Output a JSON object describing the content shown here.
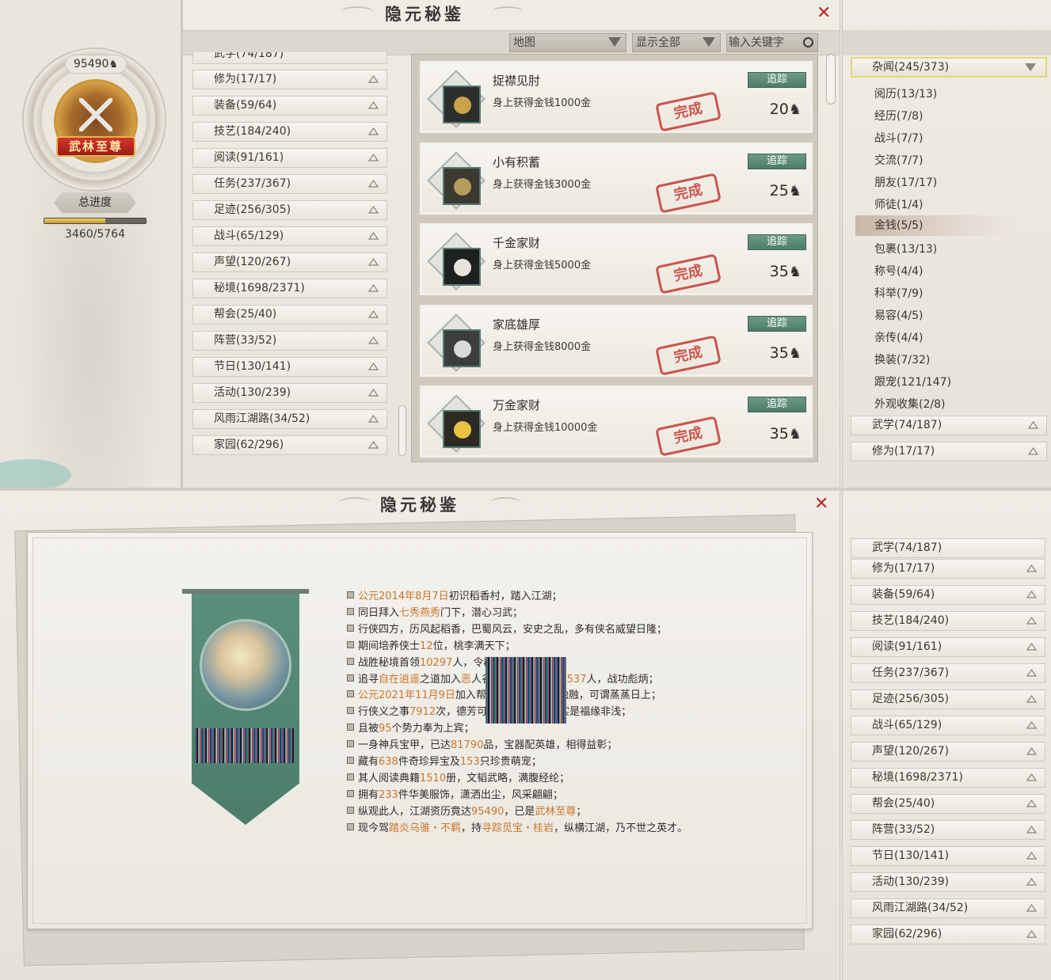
{
  "window_title": "隐元秘鉴",
  "close_symbol": "✕",
  "top": {
    "score": "95490",
    "rank_title": "武林至尊",
    "progress_label": "总进度",
    "progress_text": "3460/5764",
    "progress_fraction": 0.6,
    "filters": {
      "map_label": "地图",
      "display_label": "显示全部",
      "search_placeholder": "输入关键字"
    },
    "categories_partial": "武学(74/187)",
    "categories": [
      {
        "label": "修为(17/17)"
      },
      {
        "label": "装备(59/64)"
      },
      {
        "label": "技艺(184/240)"
      },
      {
        "label": "阅读(91/161)"
      },
      {
        "label": "任务(237/367)"
      },
      {
        "label": "足迹(256/305)"
      },
      {
        "label": "战斗(65/129)"
      },
      {
        "label": "声望(120/267)"
      },
      {
        "label": "秘境(1698/2371)"
      },
      {
        "label": "帮会(25/40)"
      },
      {
        "label": "阵营(33/52)"
      },
      {
        "label": "节日(130/141)"
      },
      {
        "label": "活动(130/239)"
      },
      {
        "label": "风雨江湖路(34/52)"
      },
      {
        "label": "家园(62/296)"
      }
    ],
    "achievements": [
      {
        "name": "捉襟见肘",
        "desc": "身上获得金钱1000金",
        "points": "20",
        "track": "追踪",
        "stamp": "完成"
      },
      {
        "name": "小有积蓄",
        "desc": "身上获得金钱3000金",
        "points": "25",
        "track": "追踪",
        "stamp": "完成"
      },
      {
        "name": "千金家财",
        "desc": "身上获得金钱5000金",
        "points": "35",
        "track": "追踪",
        "stamp": "完成"
      },
      {
        "name": "家底雄厚",
        "desc": "身上获得金钱8000金",
        "points": "35",
        "track": "追踪",
        "stamp": "完成"
      },
      {
        "name": "万金家财",
        "desc": "身上获得金钱10000金",
        "points": "35",
        "track": "追踪",
        "stamp": "完成"
      }
    ],
    "right_header": "杂闻(245/373)",
    "right_subitems": [
      "阅历(13/13)",
      "经历(7/8)",
      "战斗(7/7)",
      "交流(7/7)",
      "朋友(17/17)",
      "师徒(1/4)",
      "金钱(5/5)",
      "包裹(13/13)",
      "称号(4/4)",
      "科举(7/9)",
      "易容(4/5)",
      "亲传(4/4)",
      "换装(7/32)",
      "跟宠(121/147)",
      "外观收集(2/8)"
    ],
    "right_selected": "金钱(5/5)",
    "right_bottom": [
      "武学(74/187)",
      "修为(17/17)"
    ]
  },
  "bottom": {
    "log": [
      [
        {
          "t": "公元2014年8月7日",
          "h": true
        },
        {
          "t": "初识稻香村，踏入江湖；"
        }
      ],
      [
        {
          "t": "同日拜入"
        },
        {
          "t": "七秀燕秀",
          "h": true
        },
        {
          "t": "门下，潜心习武；"
        }
      ],
      [
        {
          "t": "行侠四方，历风起稻香，巴蜀风云，安史之乱，多有侠名威望日隆；"
        }
      ],
      [
        {
          "t": "期间培养侠士"
        },
        {
          "t": "12",
          "h": true
        },
        {
          "t": "位，桃李满天下；"
        }
      ],
      [
        {
          "t": "战胜秘境首领"
        },
        {
          "t": "10297",
          "h": true
        },
        {
          "t": "人，令"
        },
        {
          "t": "群雄闻风丧胆寒；"
        }
      ],
      [
        {
          "t": "追寻"
        },
        {
          "t": "自在逍遥",
          "h": true
        },
        {
          "t": "之道加入"
        },
        {
          "t": "恶",
          "h": true
        },
        {
          "t": "人谷，击败对阵营"
        },
        {
          "t": "20537",
          "h": true
        },
        {
          "t": "人，战功彪炳；"
        }
      ],
      [
        {
          "t": "公元2021年11月9日",
          "h": true
        },
        {
          "t": "加入帮会，与众侠其乐融融，可谓蒸蒸日上；"
        }
      ],
      [
        {
          "t": "行侠义之事"
        },
        {
          "t": "7912",
          "h": true
        },
        {
          "t": "次，德芳可嘉，屡有奇遇，实是福缘非浅；"
        }
      ],
      [
        {
          "t": "且被"
        },
        {
          "t": "95",
          "h": true
        },
        {
          "t": "个势力奉为上宾；"
        }
      ],
      [
        {
          "t": "一身神兵宝甲，已达"
        },
        {
          "t": "81790",
          "h": true
        },
        {
          "t": "品，宝器配英雄，相得益彰；"
        }
      ],
      [
        {
          "t": "藏有"
        },
        {
          "t": "638",
          "h": true
        },
        {
          "t": "件奇珍异宝及"
        },
        {
          "t": "153",
          "h": true
        },
        {
          "t": "只珍贵萌宠；"
        }
      ],
      [
        {
          "t": "其人阅读典籍"
        },
        {
          "t": "1510",
          "h": true
        },
        {
          "t": "册，文韬武略，满腹经纶；"
        }
      ],
      [
        {
          "t": "拥有"
        },
        {
          "t": "233",
          "h": true
        },
        {
          "t": "件华美服饰，潇洒出尘，风采翩翩；"
        }
      ],
      [
        {
          "t": "纵观此人，江湖资历竟达"
        },
        {
          "t": "95490",
          "h": true
        },
        {
          "t": "，已是"
        },
        {
          "t": "武林至尊",
          "h": true
        },
        {
          "t": "；"
        }
      ],
      [
        {
          "t": "现今驾"
        },
        {
          "t": "踏炎乌骓・不羁",
          "h": true
        },
        {
          "t": "，持"
        },
        {
          "t": "寻踪觅宝・桂岩",
          "h": true
        },
        {
          "t": "，纵横江湖，乃不世之英才。"
        }
      ]
    ],
    "categories_partial": "武学(74/187)",
    "categories": [
      {
        "label": "修为(17/17)"
      },
      {
        "label": "装备(59/64)"
      },
      {
        "label": "技艺(184/240)"
      },
      {
        "label": "阅读(91/161)"
      },
      {
        "label": "任务(237/367)"
      },
      {
        "label": "足迹(256/305)"
      },
      {
        "label": "战斗(65/129)"
      },
      {
        "label": "声望(120/267)"
      },
      {
        "label": "秘境(1698/2371)"
      },
      {
        "label": "帮会(25/40)"
      },
      {
        "label": "阵营(33/52)"
      },
      {
        "label": "节日(130/141)"
      },
      {
        "label": "活动(130/239)"
      },
      {
        "label": "风雨江湖路(34/52)"
      },
      {
        "label": "家园(62/296)"
      }
    ]
  }
}
